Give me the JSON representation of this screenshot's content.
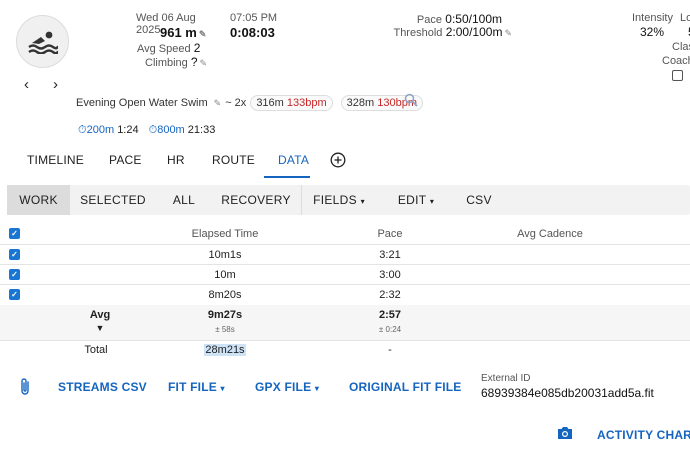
{
  "header": {
    "date": "Wed 06 Aug 2025",
    "time": "07:05 PM",
    "distance": "961 m",
    "duration": "0:08:03",
    "avg_speed_label": "Avg Speed",
    "avg_speed_value": "2",
    "climbing_label": "Climbing",
    "climbing_value": "?",
    "pace_label": "Pace",
    "pace_value": "0:50/100m",
    "threshold_label": "Threshold",
    "threshold_value": "2:00/100m",
    "intensity_label": "Intensity",
    "intensity_value": "32%",
    "lo_label": "Lo",
    "lo_value": "5",
    "class_label": "Clas",
    "coach_label": "Coach"
  },
  "activity": {
    "name": "Evening Open Water Swim",
    "interval_prefix": "~ 2x",
    "chip1_dist": "316m",
    "chip1_hr": "133bpm",
    "chip2_dist": "328m",
    "chip2_hr": "130bpm",
    "best1_dist": "200m",
    "best1_time": "1:24",
    "best2_dist": "800m",
    "best2_time": "21:33"
  },
  "tabs": {
    "timeline": "TIMELINE",
    "pace": "PACE",
    "hr": "HR",
    "route": "ROUTE",
    "data": "DATA",
    "active": "DATA"
  },
  "toolbar": {
    "work": "WORK",
    "selected": "SELECTED",
    "all": "ALL",
    "recovery": "RECOVERY",
    "fields": "FIELDS",
    "edit": "EDIT",
    "csv": "CSV"
  },
  "table": {
    "headers": {
      "elapsed": "Elapsed Time",
      "pace": "Pace",
      "cadence": "Avg Cadence"
    },
    "rows": [
      {
        "elapsed": "10m1s",
        "pace": "3:21"
      },
      {
        "elapsed": "10m",
        "pace": "3:00"
      },
      {
        "elapsed": "8m20s",
        "pace": "2:32"
      }
    ],
    "avg": {
      "label": "Avg",
      "elapsed": "9m27s",
      "elapsed_sd": "± 58s",
      "pace": "2:57",
      "pace_sd": "± 0:24"
    },
    "total": {
      "label": "Total",
      "elapsed": "28m21s",
      "pace": "-"
    }
  },
  "footer": {
    "streams_csv": "STREAMS CSV",
    "fit_file": "FIT FILE",
    "gpx_file": "GPX FILE",
    "original_fit": "ORIGINAL FIT FILE",
    "external_id_label": "External ID",
    "external_id_value": "68939384e085db20031add5a.fit",
    "activity_chart": "ACTIVITY CHART"
  },
  "colors": {
    "accent": "#1565c0",
    "hr_red": "#c62828",
    "checkbox": "#1976d2"
  }
}
